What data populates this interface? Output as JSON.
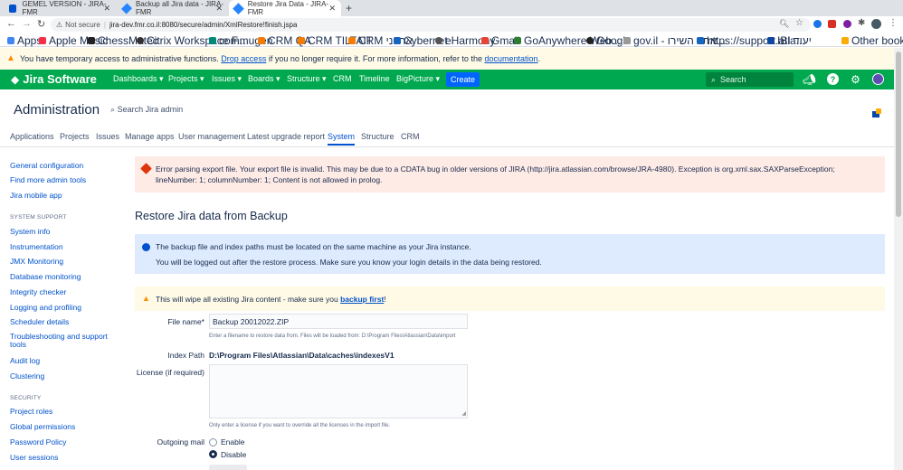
{
  "browser": {
    "tabs": [
      {
        "label": "GEMEL VERSION - JIRA-FMR"
      },
      {
        "label": "Backup all Jira data - JIRA-FMR"
      },
      {
        "label": "Restore Jira Data - JIRA-FMR"
      }
    ],
    "address": {
      "security": "Not secure",
      "url": "jira-dev.fmr.co.il:8080/secure/admin/XmlRestore!finish.jspa"
    },
    "bookmarks": [
      "Apps",
      "Apple Music",
      "ChessMatec",
      "Citrix Workspace F...",
      "commugen",
      "CRM QA",
      "CRM TILTAIT",
      "CRM ארגוני",
      "Cybernet",
      "eHarmony",
      "Gmail",
      "GoAnywhere Web...",
      "Google",
      "gov.il - אתר השירו...",
      "https://support.atla...",
      "IBI יעוד",
      "Other bookmarks"
    ]
  },
  "temp_access": {
    "text_before": "You have temporary access to administrative functions.",
    "link1": "Drop access",
    "text_mid": "if you no longer require it. For more information, refer to the",
    "link2": "documentation",
    "text_after": "."
  },
  "nav": {
    "logo": "Jira Software",
    "items": [
      "Dashboards",
      "Projects",
      "Issues",
      "Boards",
      "Structure",
      "CRM",
      "Timeline",
      "BigPicture"
    ],
    "create": "Create",
    "search_placeholder": "Search"
  },
  "admin": {
    "title": "Administration",
    "search": "Search Jira admin",
    "tabs": [
      "Applications",
      "Projects",
      "Issues",
      "Manage apps",
      "User management",
      "Latest upgrade report",
      "System",
      "Structure",
      "CRM"
    ],
    "selected_tab": "System"
  },
  "sidebar": {
    "top": [
      "General configuration",
      "Find more admin tools",
      "Jira mobile app"
    ],
    "sections": [
      {
        "heading": "SYSTEM SUPPORT",
        "items": [
          "System info",
          "Instrumentation",
          "JMX Monitoring",
          "Database monitoring",
          "Integrity checker",
          "Logging and profiling",
          "Scheduler details",
          "Troubleshooting and support tools",
          "Audit log",
          "Clustering"
        ]
      },
      {
        "heading": "SECURITY",
        "items": [
          "Project roles",
          "Global permissions",
          "Password Policy",
          "User sessions"
        ]
      }
    ]
  },
  "main": {
    "error": "Error parsing export file. Your export file is invalid. This may be due to a CDATA bug in older versions of JIRA (http://jira.atlassian.com/browse/JRA-4980). Exception is org.xml.sax.SAXParseException; lineNumber: 1; columnNumber: 1; Content is not allowed in prolog.",
    "heading": "Restore Jira data from Backup",
    "info_line1": "The backup file and index paths must be located on the same machine as your Jira instance.",
    "info_line2": "You will be logged out after the restore process. Make sure you know your login details in the data being restored.",
    "warn_text": "This will wipe all existing Jira content - make sure you",
    "warn_link": "backup first",
    "warn_end": "!",
    "form": {
      "file_label": "File name*",
      "file_value": "Backup 20012022.ZIP",
      "file_help": "Enter a filename to restore data from. Files will be loaded from: D:\\Program Files\\Atlassian\\Data\\import",
      "index_label": "Index Path",
      "index_value": "D:\\Program Files\\Atlassian\\Data\\caches\\indexesV1",
      "license_label": "License (if required)",
      "license_help": "Only enter a license if you want to override all the licenses in the import file.",
      "mail_label": "Outgoing mail",
      "mail_options": [
        "Enable",
        "Disable"
      ],
      "mail_selected": "Disable"
    }
  },
  "colors": {
    "nav": "#00a94f",
    "create": "#0065ff",
    "link": "#0052cc",
    "error_bg": "#ffebe6",
    "info_bg": "#deebff",
    "warn_bg": "#fffae6"
  }
}
